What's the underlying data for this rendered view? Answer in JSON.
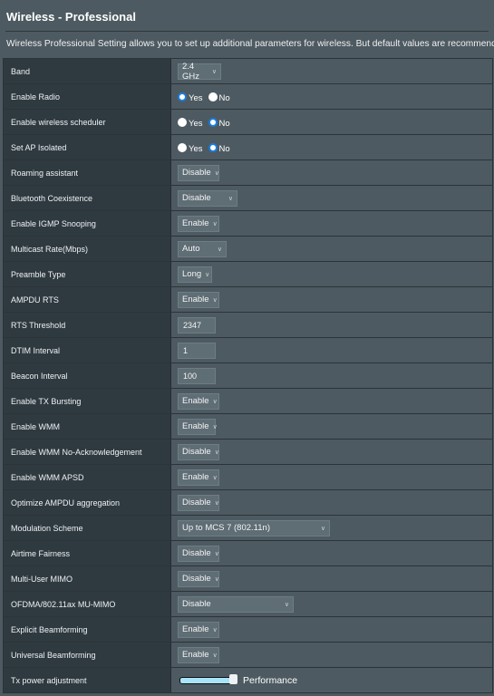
{
  "header": {
    "title": "Wireless - Professional",
    "description": "Wireless Professional Setting allows you to set up additional parameters for wireless. But default values are recommended."
  },
  "radio_labels": {
    "yes": "Yes",
    "no": "No"
  },
  "accent_color": "#1a7de0",
  "rows": [
    {
      "label": "Band",
      "type": "select",
      "value": "2.4 GHz"
    },
    {
      "label": "Enable Radio",
      "type": "radio",
      "value": "Yes"
    },
    {
      "label": "Enable wireless scheduler",
      "type": "radio",
      "value": "No"
    },
    {
      "label": "Set AP Isolated",
      "type": "radio",
      "value": "No"
    },
    {
      "label": "Roaming assistant",
      "type": "select",
      "value": "Disable"
    },
    {
      "label": "Bluetooth Coexistence",
      "type": "select",
      "value": "Disable"
    },
    {
      "label": "Enable IGMP Snooping",
      "type": "select",
      "value": "Enable"
    },
    {
      "label": "Multicast Rate(Mbps)",
      "type": "select",
      "value": "Auto"
    },
    {
      "label": "Preamble Type",
      "type": "select",
      "value": "Long"
    },
    {
      "label": "AMPDU RTS",
      "type": "select",
      "value": "Enable"
    },
    {
      "label": "RTS Threshold",
      "type": "input",
      "value": "2347"
    },
    {
      "label": "DTIM Interval",
      "type": "input",
      "value": "1"
    },
    {
      "label": "Beacon Interval",
      "type": "input",
      "value": "100"
    },
    {
      "label": "Enable TX Bursting",
      "type": "select",
      "value": "Enable"
    },
    {
      "label": "Enable WMM",
      "type": "select",
      "value": "Enable"
    },
    {
      "label": "Enable WMM No-Acknowledgement",
      "type": "select",
      "value": "Disable"
    },
    {
      "label": "Enable WMM APSD",
      "type": "select",
      "value": "Enable"
    },
    {
      "label": "Optimize AMPDU aggregation",
      "type": "select",
      "value": "Disable"
    },
    {
      "label": "Modulation Scheme",
      "type": "select",
      "value": "Up to MCS 7 (802.11n)"
    },
    {
      "label": "Airtime Fairness",
      "type": "select",
      "value": "Disable"
    },
    {
      "label": "Multi-User MIMO",
      "type": "select",
      "value": "Disable"
    },
    {
      "label": "OFDMA/802.11ax MU-MIMO",
      "type": "select",
      "value": "Disable"
    },
    {
      "label": "Explicit Beamforming",
      "type": "select",
      "value": "Enable"
    },
    {
      "label": "Universal Beamforming",
      "type": "select",
      "value": "Enable"
    },
    {
      "label": "Tx power adjustment",
      "type": "slider",
      "value_percent": 100,
      "value_label": "Performance"
    }
  ]
}
